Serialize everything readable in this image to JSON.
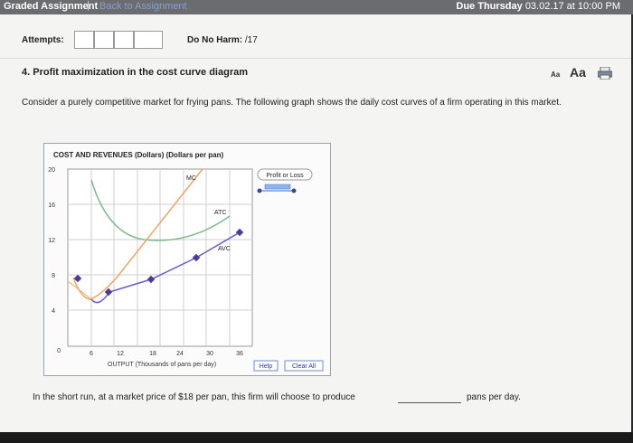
{
  "header": {
    "title": "Graded Assignment",
    "separator": "|",
    "back_link": "Back to Assignment",
    "due_label": "Due Thursday",
    "due_datetime": "03.02.17 at 10:00 PM"
  },
  "attempts": {
    "label": "Attempts:",
    "boxes": 3
  },
  "do_no_harm": {
    "label": "Do No Harm:",
    "value": "/17"
  },
  "question": {
    "title": "4. Profit maximization in the cost curve diagram",
    "font_small": "Aa",
    "font_large": "Aa",
    "description": "Consider a purely competitive market for frying pans. The following graph shows the daily cost curves of a firm operating in this market."
  },
  "graph": {
    "y_title": "COST AND REVENUES (Dollars) (Dollars per pan)",
    "x_title": "OUTPUT (Thousands of pans per day)",
    "y_ticks": [
      "20",
      "16",
      "12",
      "8",
      "4",
      "0"
    ],
    "x_ticks": [
      "6",
      "12",
      "18",
      "24",
      "30",
      "36"
    ],
    "curve_labels": {
      "mc": "MC",
      "atc": "ATC",
      "avc": "AVC"
    },
    "tool_label": "Profit or Loss",
    "help_button": "Help",
    "clear_button": "Clear All",
    "colors": {
      "mc": "#f4a460",
      "atc": "#7cba8a",
      "avc": "#6a5acd",
      "grid": "#c8c8c8",
      "marker": "#4a3aa0",
      "tool": "#5b7fd1"
    }
  },
  "bottom": {
    "prompt": "In the short run, at a market price of $18 per pan, this firm will choose to produce",
    "suffix": "pans per day."
  }
}
